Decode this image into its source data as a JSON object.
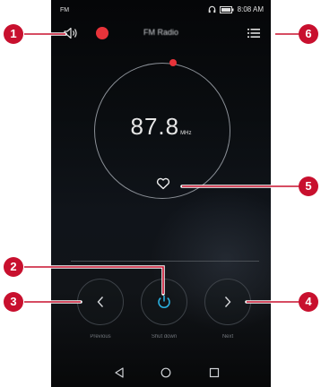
{
  "status_bar": {
    "left_label": "FM",
    "time": "8:08 AM"
  },
  "title_bar": {
    "title": "FM Radio"
  },
  "station": {
    "frequency": "87.8",
    "unit": "MHz"
  },
  "controls": {
    "previous_label": "Previous",
    "power_label": "Shut down",
    "next_label": "Next"
  },
  "callouts": [
    "1",
    "2",
    "3",
    "4",
    "5",
    "6"
  ],
  "colors": {
    "accent": "#e8333a",
    "power": "#2ab0e0",
    "callout": "#c8102e"
  },
  "icons": [
    "volume-icon",
    "record-icon",
    "menu-icon",
    "favorite-icon",
    "previous-icon",
    "power-icon",
    "next-icon",
    "back-icon",
    "home-icon",
    "recent-apps-icon"
  ]
}
